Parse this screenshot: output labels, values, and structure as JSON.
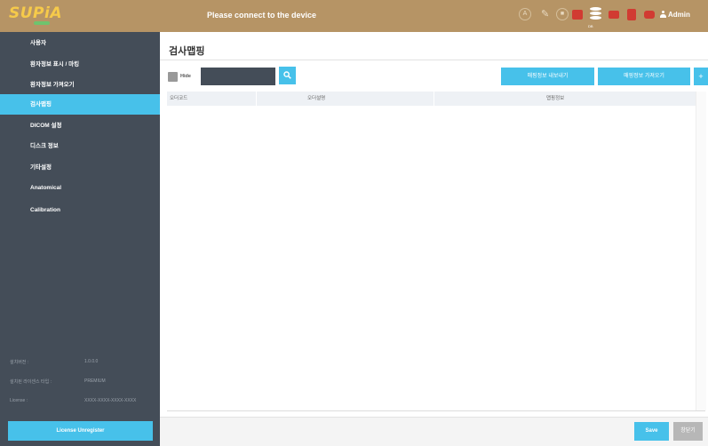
{
  "app": {
    "logo": "SUPiA",
    "status_message": "Please connect to the device",
    "db_label": "DB",
    "user": "Admin"
  },
  "sidebar": {
    "items": [
      {
        "label": "사용자"
      },
      {
        "label": "환자정보 표시 / 마킹"
      },
      {
        "label": "환자정보 가져오기"
      },
      {
        "label": "검사맵핑"
      },
      {
        "label": "DICOM 설정"
      },
      {
        "label": "디스크 정보"
      },
      {
        "label": "기타설정"
      },
      {
        "label": "Anatomical"
      },
      {
        "label": "Calibration"
      }
    ],
    "version_label": "설치버전 :",
    "version_value": "1.0.0.0",
    "license_type_label": "설치된 라이센스 타입 :",
    "license_type_value": "PREMIUM",
    "license_label": "License :",
    "license_value": "XXXX-XXXX-XXXX-XXXX",
    "unregister_label": "License Unregister"
  },
  "main": {
    "title": "검사맵핑",
    "hide_label": "Hide",
    "search_value": "",
    "export_label": "매핑정보 내보내기",
    "import_label": "매핑정보 가져오기",
    "add_label": "+",
    "columns": [
      "오더코드",
      "오더설명",
      "맵핑정보"
    ],
    "save_label": "Save",
    "close_label": "창닫기"
  },
  "colors": {
    "topbar": "#b69465",
    "sidebar": "#444d58",
    "accent": "#47c1ea"
  }
}
